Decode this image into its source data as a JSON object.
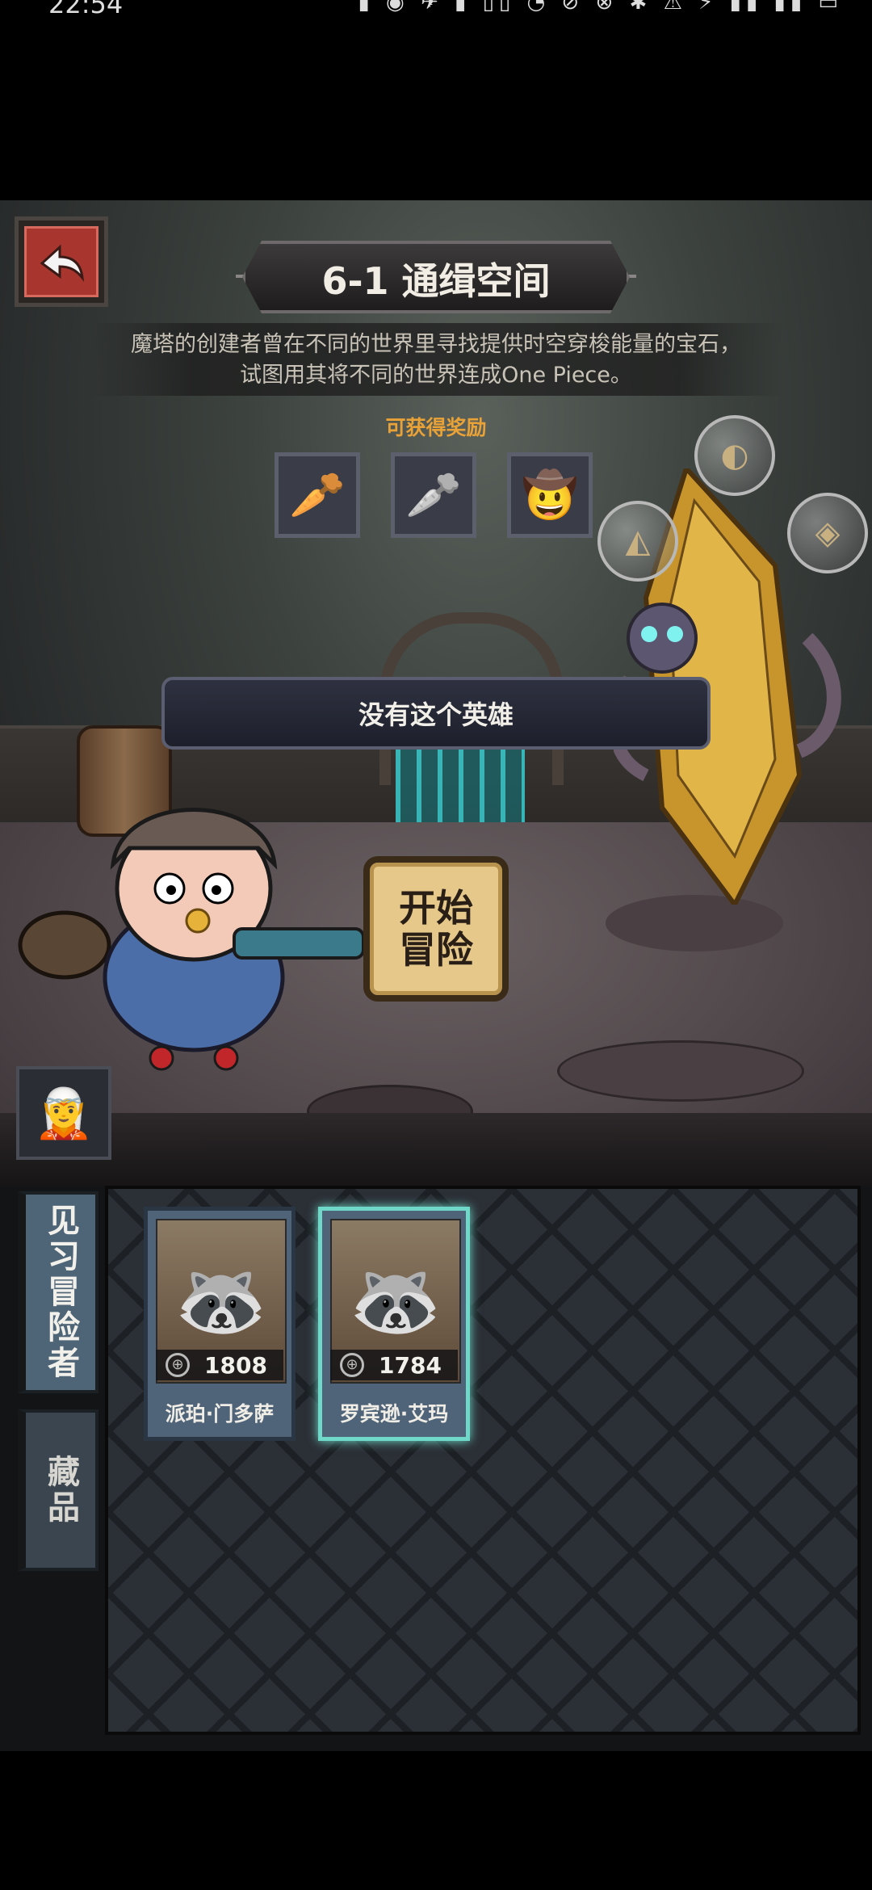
{
  "status_bar": {
    "time": "22:54",
    "icons": "▮ ◉ ✈ ▮ ▯▯ ◔       ⊘ ⊗ ✱ ⚠ ⚡ ▮▮ ▮▮ ▭"
  },
  "level": {
    "title": "6-1 通缉空间",
    "description": "魔塔的创建者曾在不同的世界里寻找提供时空穿梭能量的宝石，试图用其将不同的世界连成One Piece。"
  },
  "rewards": {
    "label": "可获得奖励",
    "items": [
      {
        "icon": "golden-carrot-icon",
        "glyph": "🥕"
      },
      {
        "icon": "silver-carrot-icon",
        "glyph": "🥕"
      },
      {
        "icon": "cowboy-hat-icon",
        "glyph": "🤠"
      }
    ]
  },
  "boss": {
    "bubbles": [
      "◐",
      "◭",
      "◈"
    ]
  },
  "toast": {
    "message": "没有这个英雄"
  },
  "start_button": {
    "label": "开始冒险"
  },
  "side_tabs": {
    "apprentice": "见习冒险者",
    "collection": "藏品"
  },
  "hero_cards": [
    {
      "name": "派珀·门多萨",
      "power": "1808",
      "selected": false
    },
    {
      "name": "罗宾逊·艾玛",
      "power": "1784",
      "selected": true
    }
  ],
  "colors": {
    "accent_orange": "#e8a238",
    "back_red": "#a8362e",
    "selected_teal": "#6fd8c8",
    "tab_blue": "#4e6477"
  }
}
